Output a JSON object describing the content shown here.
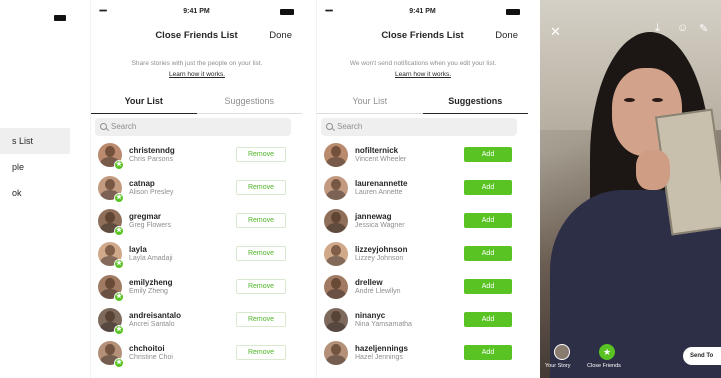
{
  "left_panel": {
    "items": [
      {
        "label": "s List",
        "selected": true
      },
      {
        "label": "ple",
        "selected": false
      },
      {
        "label": "ok",
        "selected": false
      }
    ]
  },
  "panel1": {
    "status": {
      "signal": "•••••",
      "time": "9:41 PM"
    },
    "title": "Close Friends List",
    "done": "Done",
    "description": "Share stories with just the people on your list.",
    "learn": "Learn how it works.",
    "tabs": [
      {
        "label": "Your List",
        "active": true
      },
      {
        "label": "Suggestions",
        "active": false
      }
    ],
    "search_placeholder": "Search",
    "button_label": "Remove",
    "rows": [
      {
        "username": "christenndg",
        "fullname": "Chris Parsons"
      },
      {
        "username": "catnap",
        "fullname": "Alison Presley"
      },
      {
        "username": "gregmar",
        "fullname": "Greg Flowers"
      },
      {
        "username": "layla",
        "fullname": "Layla Amadaji"
      },
      {
        "username": "emilyzheng",
        "fullname": "Emily Zheng"
      },
      {
        "username": "andreisantalo",
        "fullname": "Ancrei Santalo"
      },
      {
        "username": "chchoitoi",
        "fullname": "Christine Choi"
      }
    ]
  },
  "panel2": {
    "status": {
      "signal": "•••••",
      "time": "9:41 PM"
    },
    "title": "Close Friends List",
    "done": "Done",
    "description": "We won't send notifications when you edit your list.",
    "learn": "Learn how it works.",
    "tabs": [
      {
        "label": "Your List",
        "active": false
      },
      {
        "label": "Suggestions",
        "active": true
      }
    ],
    "search_placeholder": "Search",
    "button_label": "Add",
    "rows": [
      {
        "username": "nofilternick",
        "fullname": "Vincent Wheeler"
      },
      {
        "username": "laurenannette",
        "fullname": "Lauren Annette"
      },
      {
        "username": "jannewag",
        "fullname": "Jessica Wagner"
      },
      {
        "username": "lizzeyjohnson",
        "fullname": "Lizzey Johnson"
      },
      {
        "username": "drellew",
        "fullname": "André Llewllyn"
      },
      {
        "username": "ninanyc",
        "fullname": "Nina Yamsamatha"
      },
      {
        "username": "hazeljennings",
        "fullname": "Hazel Jennings"
      }
    ]
  },
  "story": {
    "your_story": "Your Story",
    "close_friends": "Close Friends",
    "send_to": "Send To"
  },
  "colors": {
    "accent": "#58c322",
    "text": "#262626",
    "muted": "#8e8e8e"
  }
}
